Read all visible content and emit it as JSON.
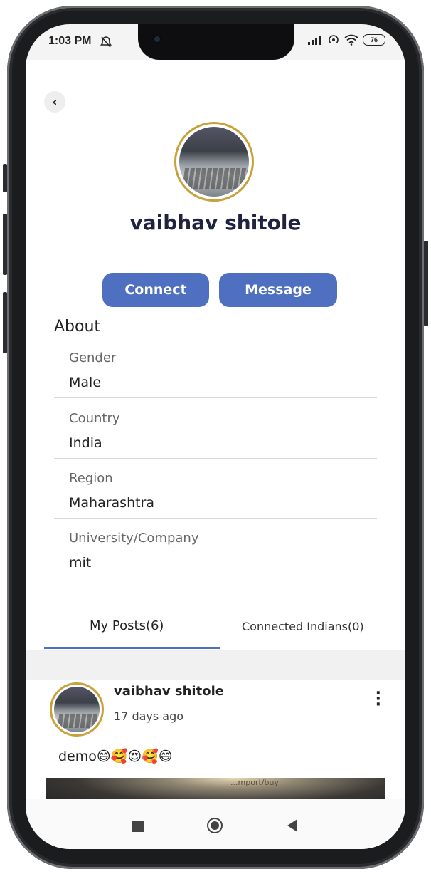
{
  "status_bar": {
    "time": "1:03 PM",
    "battery": "76"
  },
  "profile": {
    "name": "vaibhav shitole"
  },
  "actions": {
    "connect_label": "Connect",
    "message_label": "Message"
  },
  "about": {
    "title": "About",
    "fields": [
      {
        "label": "Gender",
        "value": "Male"
      },
      {
        "label": "Country",
        "value": "India"
      },
      {
        "label": "Region",
        "value": "Maharashtra"
      },
      {
        "label": "University/Company",
        "value": "mit"
      }
    ]
  },
  "tabs": [
    {
      "label": "My Posts(6)",
      "active": true
    },
    {
      "label": "Connected Indians(0)",
      "active": false
    }
  ],
  "post": {
    "author": "vaibhav shitole",
    "time": "17 days ago",
    "text": "demo😄🥰😍🥰😄",
    "image_caption": "...mport/buy"
  },
  "colors": {
    "accent": "#4f6fc0",
    "avatar_ring": "#c9a13b"
  }
}
